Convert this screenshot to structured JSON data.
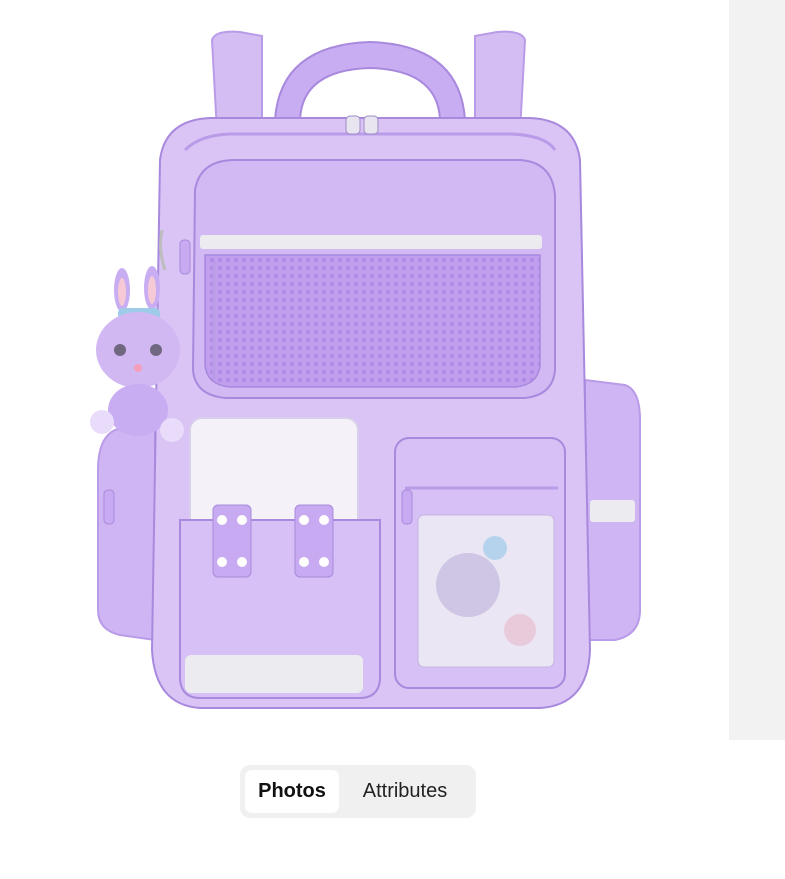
{
  "tabs": {
    "photos_label": "Photos",
    "attributes_label": "Attributes",
    "active": "Photos"
  },
  "product_image": {
    "subject": "backpack-photo",
    "colors": {
      "body": "#d9c4f5",
      "body_dark": "#b99be8",
      "mesh": "#c6a9f0",
      "reflective_strip": "#ececf0",
      "white_panel": "#f4f2f8",
      "outline": "#a889dd"
    }
  },
  "colors": {
    "side_panel_bg": "#f2f2f2",
    "tab_group_bg": "#f0f0f0",
    "active_tab_bg": "#ffffff"
  }
}
